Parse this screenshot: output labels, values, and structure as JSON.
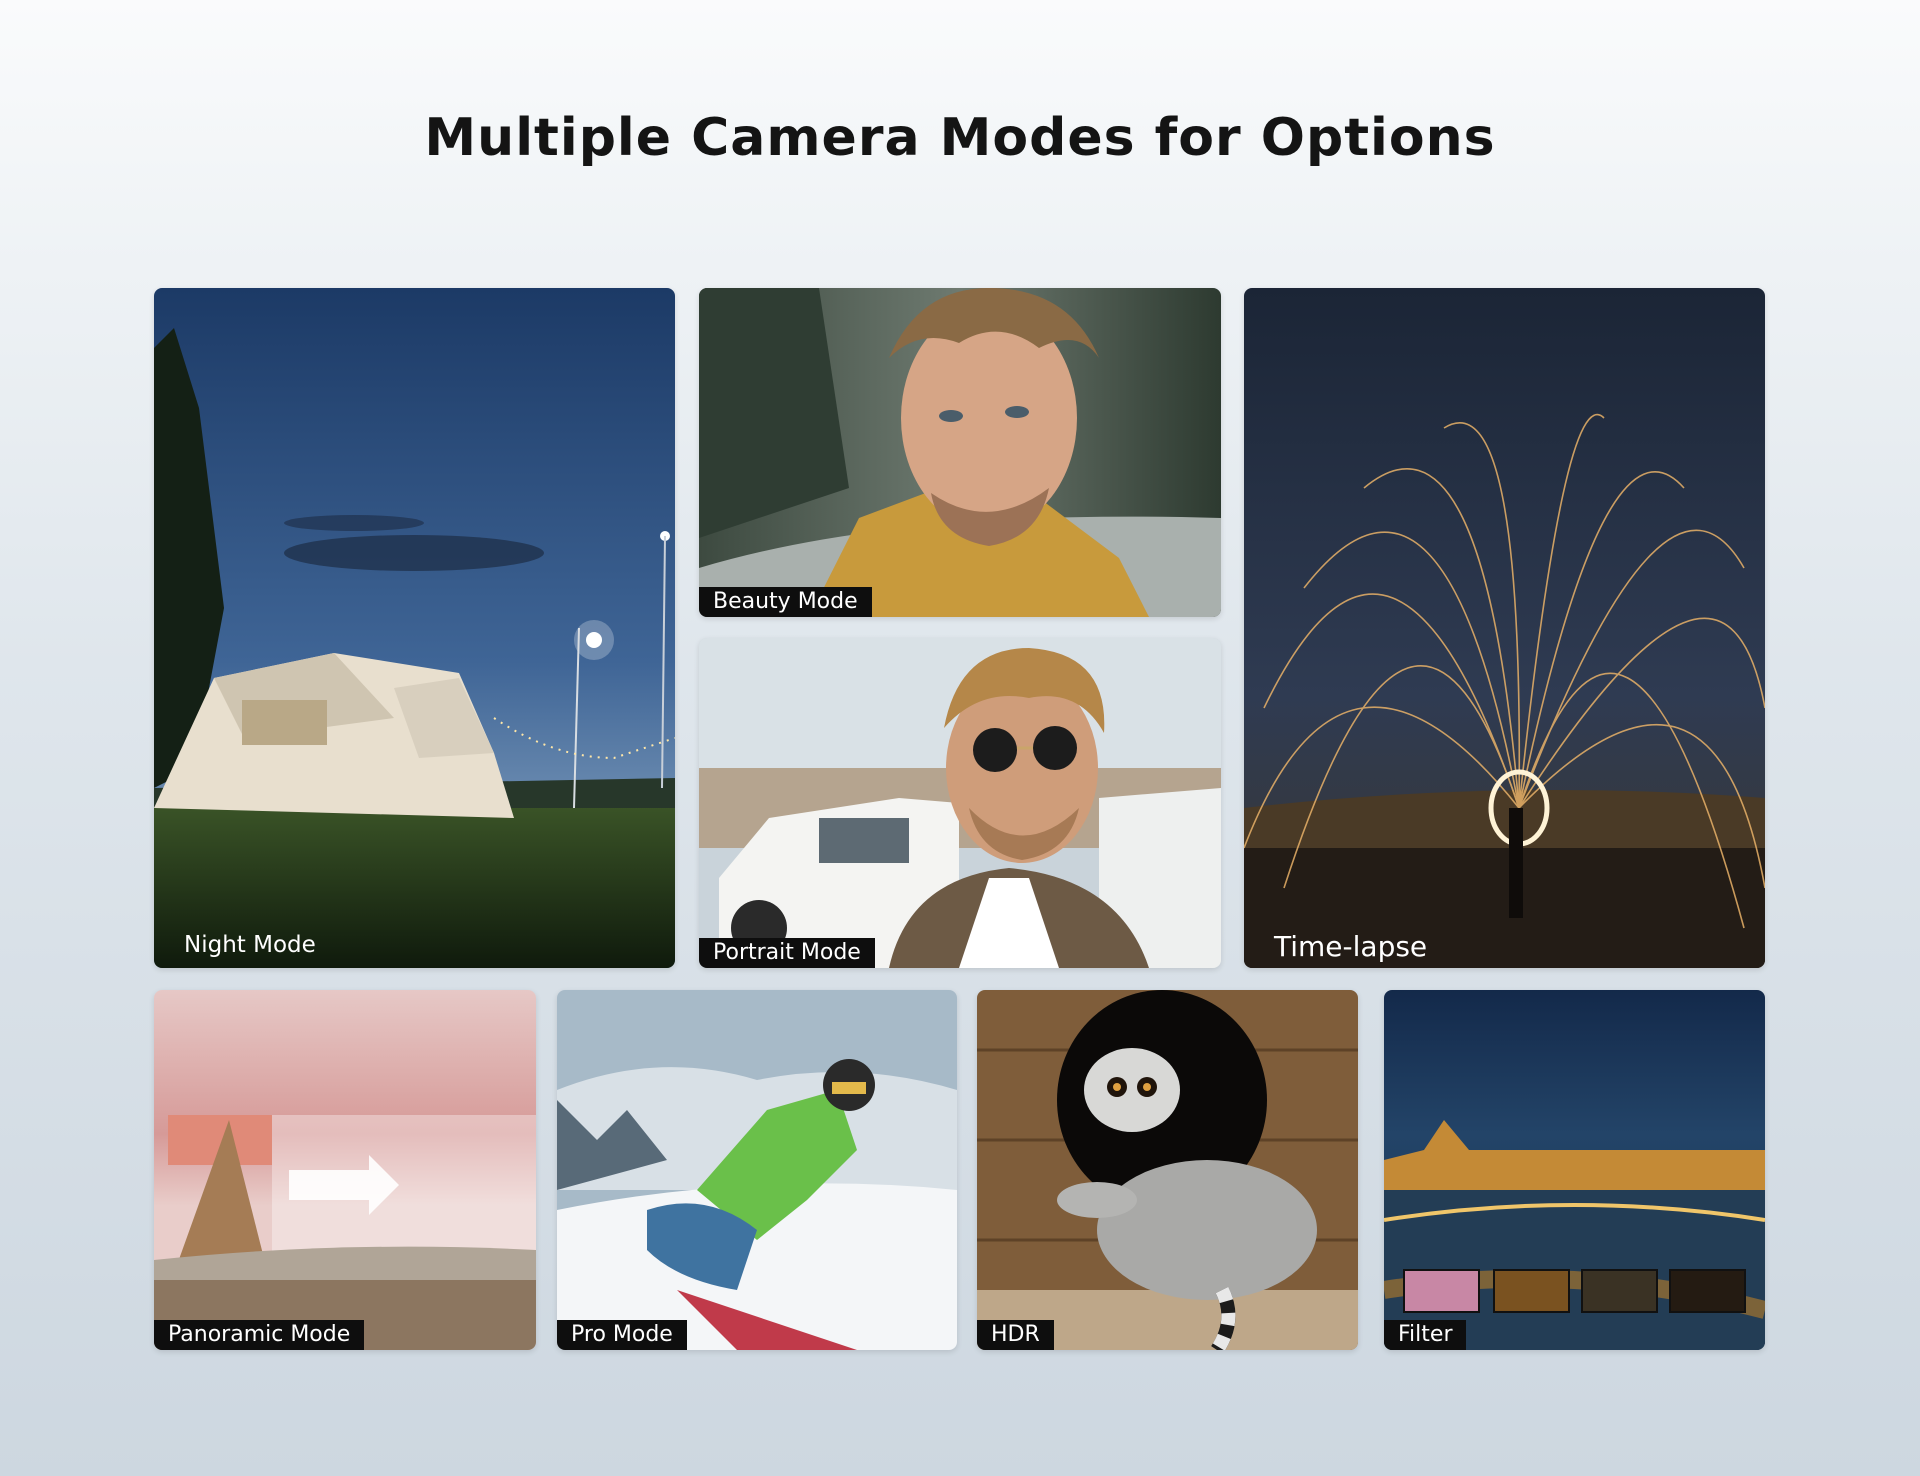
{
  "page": {
    "title": "Multiple Camera Modes for Options"
  },
  "modes": {
    "night": "Night Mode",
    "beauty": "Beauty Mode",
    "portrait": "Portrait Mode",
    "timelapse": "Time-lapse",
    "panoramic": "Panoramic Mode",
    "pro": "Pro Mode",
    "hdr": "HDR",
    "filter": "Filter"
  }
}
